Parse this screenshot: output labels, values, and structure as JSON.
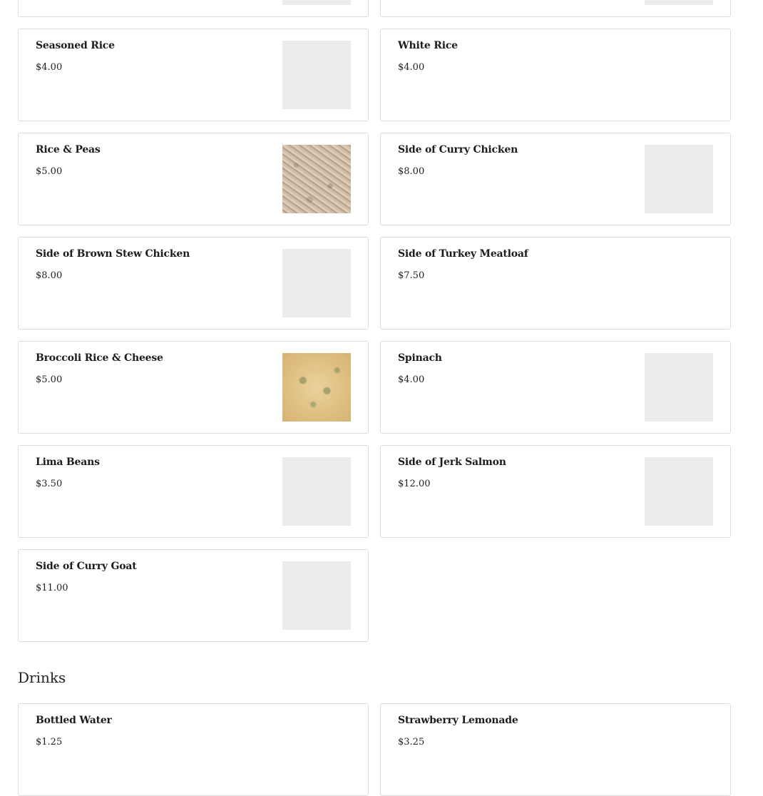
{
  "sections": {
    "drinks_title": "Drinks"
  },
  "items": {
    "seasoned_rice": {
      "name": "Seasoned Rice",
      "price": "$4.00"
    },
    "white_rice": {
      "name": "White Rice",
      "price": "$4.00"
    },
    "rice_peas": {
      "name": "Rice & Peas",
      "price": "$5.00"
    },
    "curry_chicken": {
      "name": "Side of Curry Chicken",
      "price": "$8.00"
    },
    "brown_stew": {
      "name": "Side of Brown Stew Chicken",
      "price": "$8.00"
    },
    "turkey_meatloaf": {
      "name": "Side of Turkey Meatloaf",
      "price": "$7.50"
    },
    "broccoli_rice": {
      "name": "Broccoli Rice & Cheese",
      "price": "$5.00"
    },
    "spinach": {
      "name": "Spinach",
      "price": "$4.00"
    },
    "lima_beans": {
      "name": "Lima Beans",
      "price": "$3.50"
    },
    "jerk_salmon": {
      "name": "Side of Jerk Salmon",
      "price": "$12.00"
    },
    "curry_goat": {
      "name": "Side of Curry Goat",
      "price": "$11.00"
    },
    "bottled_water": {
      "name": "Bottled Water",
      "price": "$1.25"
    },
    "strawberry_lemonade": {
      "name": "Strawberry Lemonade",
      "price": "$3.25"
    }
  }
}
